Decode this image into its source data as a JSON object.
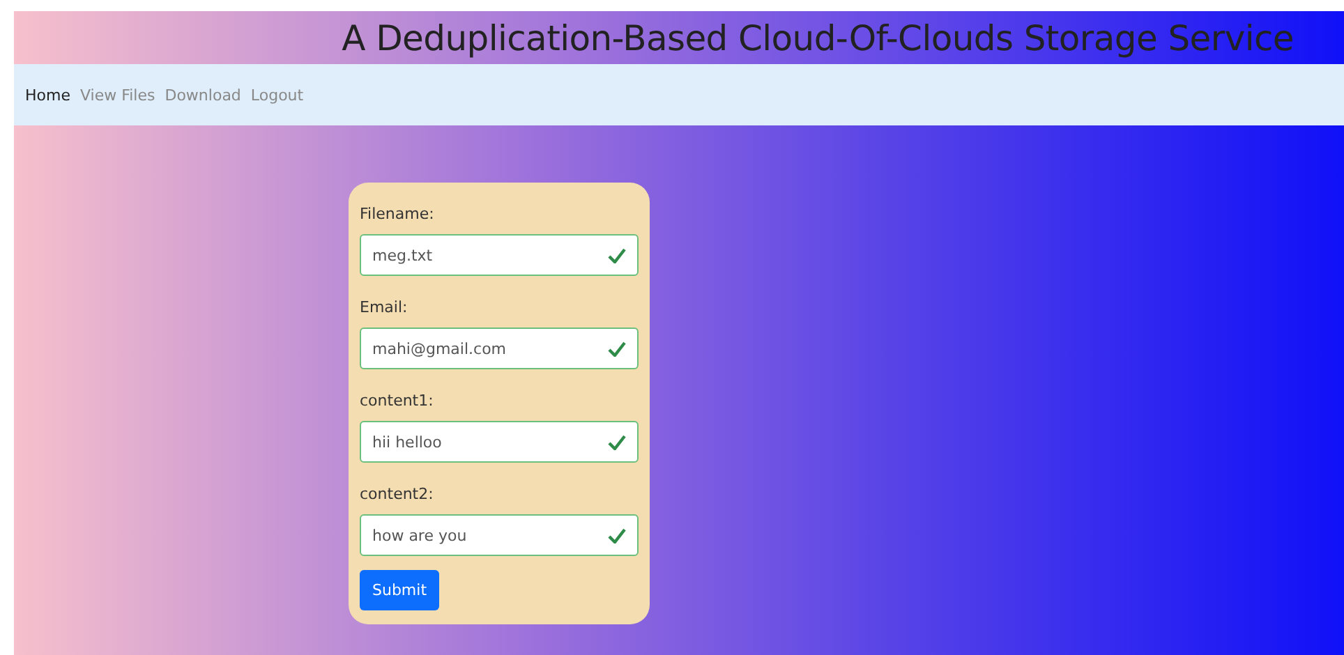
{
  "header": {
    "title": "A Deduplication-Based Cloud-Of-Clouds Storage Service"
  },
  "nav": [
    {
      "label": "Home",
      "selected": true
    },
    {
      "label": "View Files",
      "selected": false
    },
    {
      "label": "Download",
      "selected": false
    },
    {
      "label": "Logout",
      "selected": false
    }
  ],
  "form": {
    "fields": [
      {
        "label": "Filename:",
        "value": "meg.txt",
        "valid": true
      },
      {
        "label": "Email:",
        "value": "mahi@gmail.com",
        "valid": true
      },
      {
        "label": "content1:",
        "value": "hii helloo",
        "valid": true
      },
      {
        "label": "content2:",
        "value": "how are you",
        "valid": true
      }
    ],
    "submit": "Submit"
  }
}
